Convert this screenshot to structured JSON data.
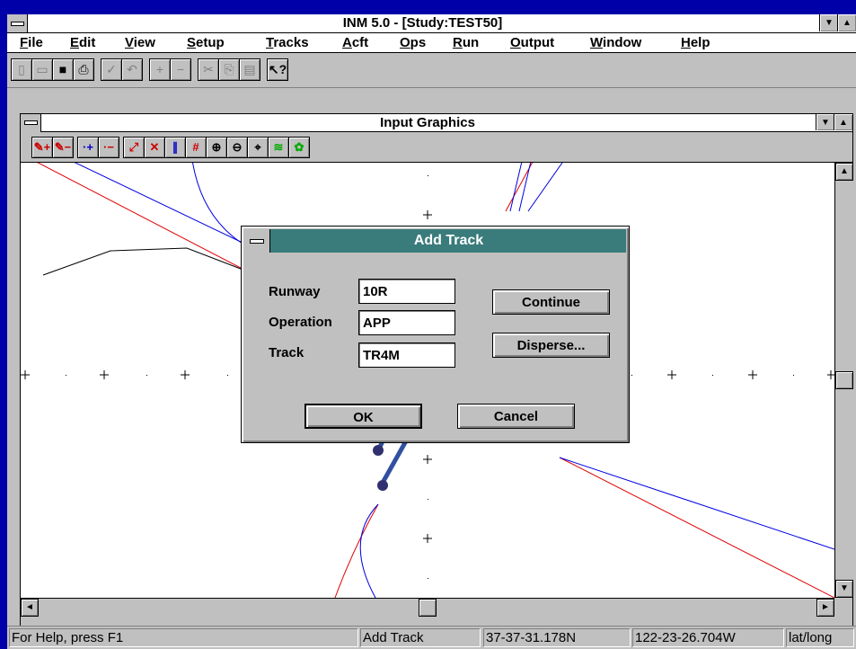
{
  "app": {
    "title": "INM 5.0 - [Study:TEST50]"
  },
  "menu": [
    {
      "label": "File",
      "u": "F",
      "rest": "ile"
    },
    {
      "label": "Edit",
      "u": "E",
      "rest": "dit"
    },
    {
      "label": "View",
      "u": "V",
      "rest": "iew"
    },
    {
      "label": "Setup",
      "u": "S",
      "rest": "etup"
    },
    {
      "label": "Tracks",
      "u": "T",
      "rest": "racks"
    },
    {
      "label": "Acft",
      "u": "A",
      "rest": "cft"
    },
    {
      "label": "Ops",
      "u": "O",
      "rest": "ps"
    },
    {
      "label": "Run",
      "u": "R",
      "rest": "un"
    },
    {
      "label": "Output",
      "u": "O",
      "rest": "utput"
    },
    {
      "label": "Window",
      "u": "W",
      "rest": "indow"
    },
    {
      "label": "Help",
      "u": "H",
      "rest": "elp"
    }
  ],
  "child": {
    "title": "Input Graphics"
  },
  "dialog": {
    "title": "Add Track",
    "runway_label": "Runway",
    "runway_value": "10R",
    "operation_label": "Operation",
    "operation_value": "APP",
    "track_label": "Track",
    "track_value": "TR4M",
    "continue_label": "Continue",
    "disperse_label": "Disperse...",
    "ok_label": "OK",
    "cancel_label": "Cancel"
  },
  "status": {
    "help": "For Help, press F1",
    "mode": "Add Track",
    "lat": "37-37-31.178N",
    "lon": "122-23-26.704W",
    "units": "lat/long"
  },
  "colors": {
    "dialog_caption": "#3a7b7b",
    "desktop": "#0000a8"
  }
}
